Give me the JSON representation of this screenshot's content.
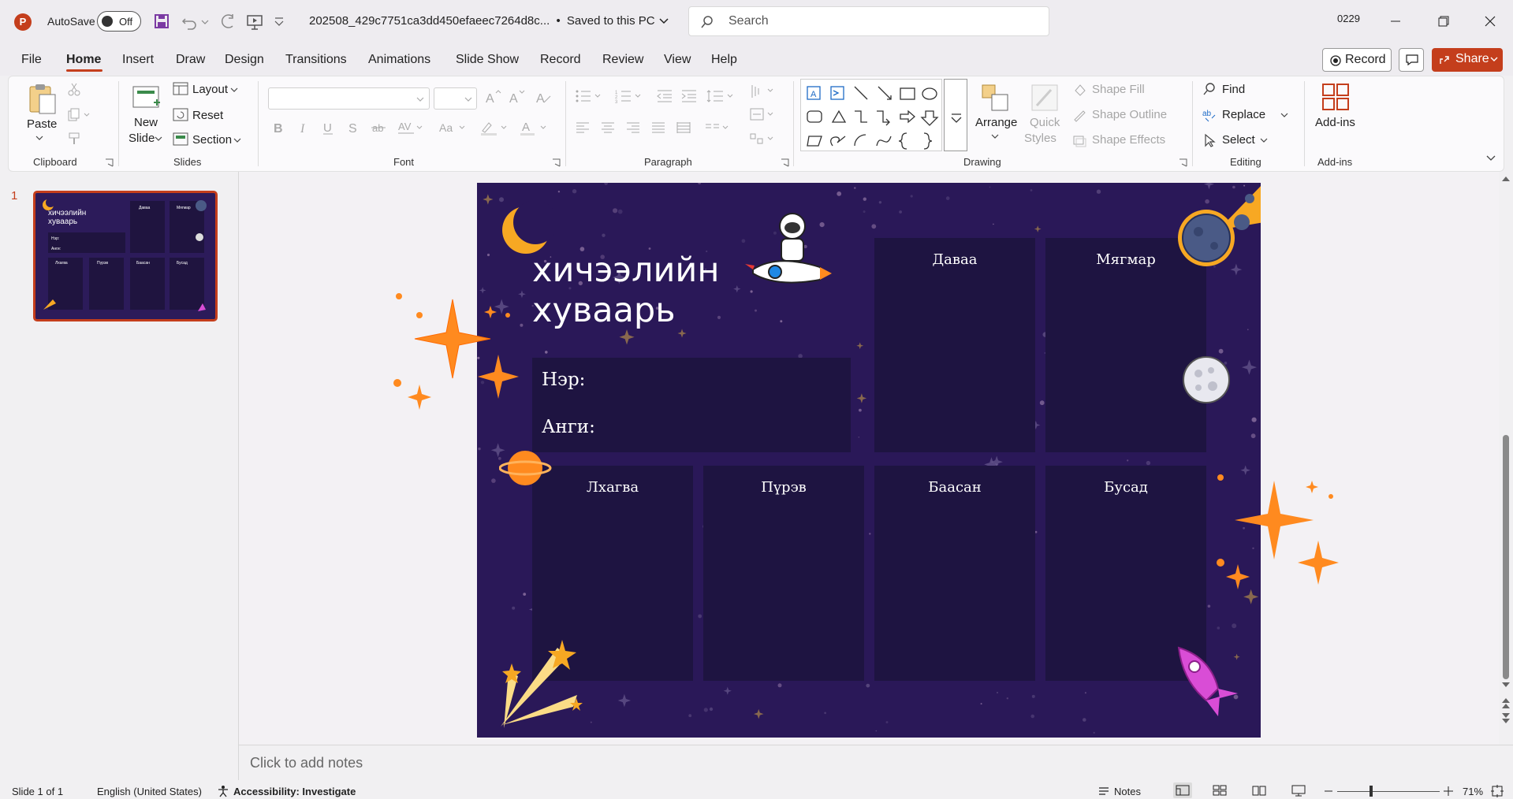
{
  "titlebar": {
    "app_logo": "P",
    "autosave_label": "AutoSave",
    "autosave_state": "Off",
    "filename": "202508_429c7751ca3dd450efaeec7264d8c...",
    "save_status": "Saved to this PC",
    "search_placeholder": "Search",
    "user_id": "0229"
  },
  "menu": {
    "tabs": [
      "File",
      "Home",
      "Insert",
      "Draw",
      "Design",
      "Transitions",
      "Animations",
      "Slide Show",
      "Record",
      "Review",
      "View",
      "Help"
    ],
    "active_tab": "Home",
    "record_label": "Record",
    "share_label": "Share"
  },
  "ribbon": {
    "clipboard": {
      "paste": "Paste",
      "group": "Clipboard"
    },
    "slides": {
      "new_slide_1": "New",
      "new_slide_2": "Slide",
      "layout": "Layout",
      "reset": "Reset",
      "section": "Section",
      "group": "Slides"
    },
    "font": {
      "group": "Font",
      "font_name": "",
      "font_size": ""
    },
    "paragraph": {
      "group": "Paragraph"
    },
    "drawing": {
      "arrange": "Arrange",
      "quick_1": "Quick",
      "quick_2": "Styles",
      "shape_fill": "Shape Fill",
      "shape_outline": "Shape Outline",
      "shape_effects": "Shape Effects",
      "group": "Drawing"
    },
    "editing": {
      "find": "Find",
      "replace": "Replace",
      "select": "Select",
      "group": "Editing"
    },
    "addins": {
      "label": "Add-ins",
      "group": "Add-ins"
    }
  },
  "thumbnail": {
    "number": "1",
    "title": "хичээлийн хуваарь"
  },
  "slide": {
    "title": "хичээлийн хуваарь",
    "name_label": "Нэр:",
    "class_label": "Анги:",
    "days": [
      "Даваа",
      "Мягмар",
      "Лхагва",
      "Пүрэв",
      "Баасан",
      "Бусад"
    ],
    "colors": {
      "background": "#2a1858",
      "cell": "#1e1441",
      "accent": "#ff8a1f"
    }
  },
  "notes": {
    "placeholder": "Click to add notes"
  },
  "status": {
    "slide_info": "Slide 1 of 1",
    "language": "English (United States)",
    "accessibility": "Accessibility: Investigate",
    "notes_label": "Notes",
    "zoom": "71%"
  },
  "colors": {
    "accent": "#c43e1c",
    "ribbon_bg": "#fbfafc",
    "window_bg": "#f1f0f2"
  }
}
